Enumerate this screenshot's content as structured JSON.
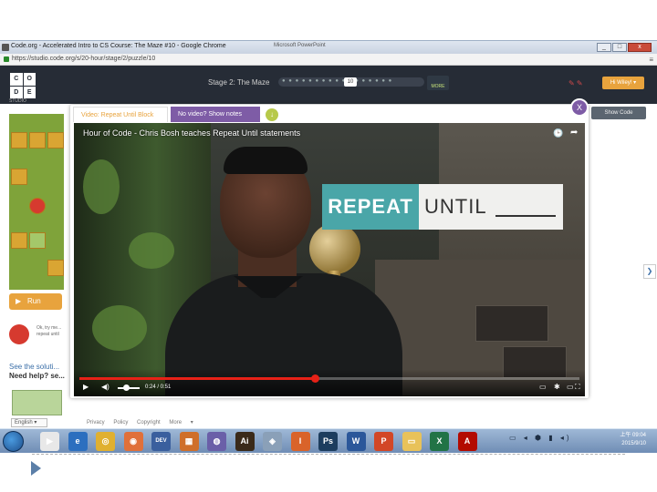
{
  "window": {
    "title": "Code.org - Accelerated Intro to CS Course: The Maze #10 - Google Chrome",
    "secondary_title": "Microsoft PowerPoint",
    "buttons": {
      "minimize": "_",
      "maximize": "□",
      "close": "x"
    }
  },
  "address_bar": {
    "url": "https://studio.code.org/s/20-hour/stage/2/puzzle/10",
    "menu_icon": "≡"
  },
  "site_header": {
    "logo_letters": [
      "C",
      "O",
      "D",
      "E"
    ],
    "logo_sub": "STUDIO",
    "stage_label": "Stage 2: The Maze",
    "progress_dots": "● ● ● ● ● ● ●         ● ● ● ● ● ● ● ● ● ●",
    "current_puzzle": "10",
    "more_label": "MORE",
    "sign_in": "Hi Wiley! ▾",
    "show_code": "Show Code"
  },
  "left_panel": {
    "run_label": "Run",
    "hint_text": "Ok, try me... repeat until",
    "see_solution": "See the soluti...",
    "need_help": "Need help? se...",
    "language": "English ▾",
    "footer_links": "Privacy Policy  Copyright  More ▾"
  },
  "dialog": {
    "tab_active": "Video: Repeat Until Block",
    "tab_inactive": "No video? Show notes",
    "download_icon": "↓",
    "close_label": "X"
  },
  "video": {
    "title": "Hour of Code - Chris Bosh teaches Repeat Until statements",
    "overlay_repeat": "REPEAT",
    "overlay_until": "UNTIL",
    "time_display": "0:24 / 0:51",
    "progress_fraction": 0.47,
    "watch_later_icon": "🕒",
    "share_icon": "➦",
    "play_icon": "▶",
    "volume_icon": "◀)",
    "cc_icon": "▭",
    "settings_icon": "✱",
    "youtube_icon": "▭",
    "fullscreen_icon": "⛶"
  },
  "taskbar": {
    "icons": [
      {
        "name": "media-player",
        "glyph": "▶",
        "color": "#e8e8e8"
      },
      {
        "name": "internet-explorer",
        "glyph": "e",
        "color": "#2c6fbf"
      },
      {
        "name": "chrome",
        "glyph": "◎",
        "color": "#e0b030"
      },
      {
        "name": "firefox",
        "glyph": "◉",
        "color": "#e0703a"
      },
      {
        "name": "dev",
        "glyph": "DEV",
        "color": "#3a5f9e"
      },
      {
        "name": "apps",
        "glyph": "▦",
        "color": "#cf6f2a"
      },
      {
        "name": "orb",
        "glyph": "◍",
        "color": "#6a5fa8"
      },
      {
        "name": "illustrator",
        "glyph": "Ai",
        "color": "#3a2a1a"
      },
      {
        "name": "shapes",
        "glyph": "◈",
        "color": "#8aa0b8"
      },
      {
        "name": "app-i",
        "glyph": "I",
        "color": "#d9632a"
      },
      {
        "name": "photoshop",
        "glyph": "Ps",
        "color": "#1d3d5e"
      },
      {
        "name": "word",
        "glyph": "W",
        "color": "#2b579a"
      },
      {
        "name": "powerpoint",
        "glyph": "P",
        "color": "#d24726"
      },
      {
        "name": "explorer",
        "glyph": "▭",
        "color": "#e8c25a"
      },
      {
        "name": "excel",
        "glyph": "X",
        "color": "#217346"
      },
      {
        "name": "acrobat",
        "glyph": "A",
        "color": "#b30b00"
      }
    ],
    "tray": "▭ ◂ ⬢ ▮ ◂)",
    "clock_time": "上午 09:04",
    "clock_date": "2015/9/10"
  }
}
